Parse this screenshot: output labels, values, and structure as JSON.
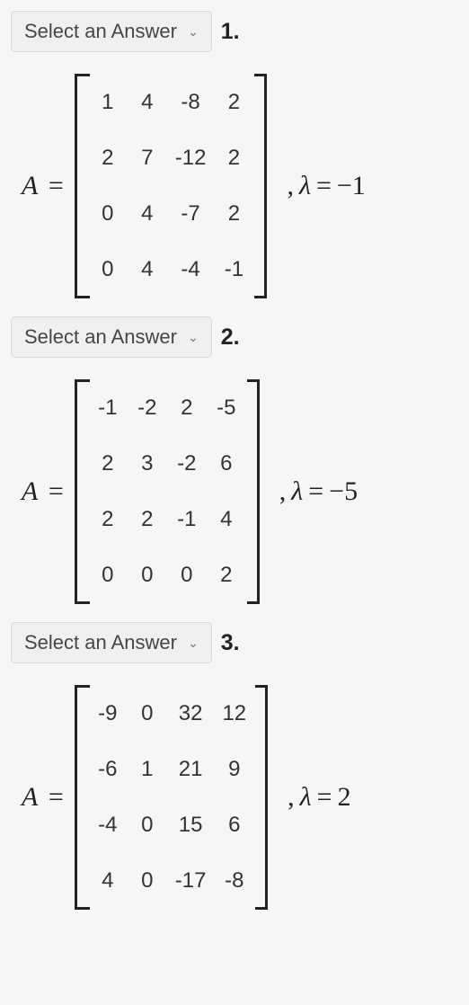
{
  "select_placeholder": "Select an Answer",
  "items": [
    {
      "qnum": "1.",
      "lhs": "A",
      "matrix": [
        [
          "1",
          "4",
          "-8",
          "2"
        ],
        [
          "2",
          "7",
          "-12",
          "2"
        ],
        [
          "0",
          "4",
          "-7",
          "2"
        ],
        [
          "0",
          "4",
          "-4",
          "-1"
        ]
      ],
      "lambda_label": "λ",
      "lambda_value": "−1"
    },
    {
      "qnum": "2.",
      "lhs": "A",
      "matrix": [
        [
          "-1",
          "-2",
          "2",
          "-5"
        ],
        [
          "2",
          "3",
          "-2",
          "6"
        ],
        [
          "2",
          "2",
          "-1",
          "4"
        ],
        [
          "0",
          "0",
          "0",
          "2"
        ]
      ],
      "lambda_label": "λ",
      "lambda_value": "−5"
    },
    {
      "qnum": "3.",
      "lhs": "A",
      "matrix": [
        [
          "-9",
          "0",
          "32",
          "12"
        ],
        [
          "-6",
          "1",
          "21",
          "9"
        ],
        [
          "-4",
          "0",
          "15",
          "6"
        ],
        [
          "4",
          "0",
          "-17",
          "-8"
        ]
      ],
      "lambda_label": "λ",
      "lambda_value": "2"
    }
  ]
}
